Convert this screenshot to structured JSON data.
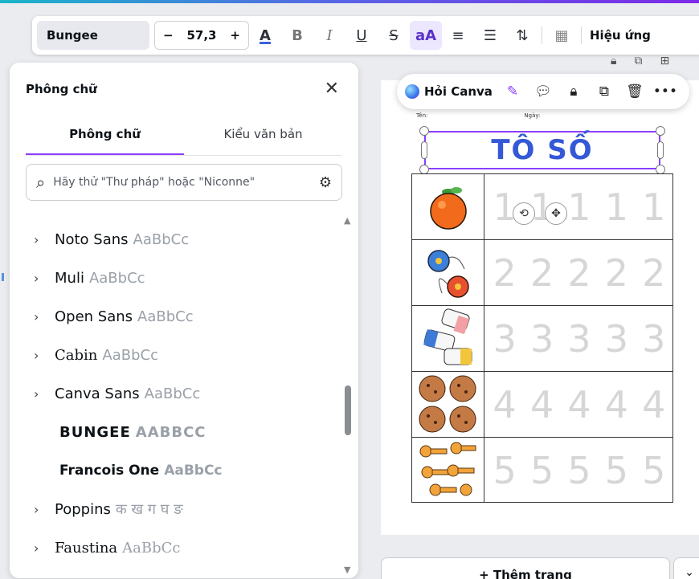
{
  "toolbar": {
    "font_name": "Bungee",
    "size_minus": "−",
    "font_size": "57,3",
    "size_plus": "+",
    "text_color_glyph": "A",
    "bold_glyph": "B",
    "italic_glyph": "I",
    "underline_glyph": "U",
    "strike_glyph": "S",
    "case_glyph": "aA",
    "align_glyph": "≡",
    "list_glyph": "☰",
    "spacing_glyph": "⇅",
    "transparency_glyph": "▦",
    "effects_label": "Hiệu ứng"
  },
  "panel": {
    "title": "Phông chữ",
    "close_glyph": "✕",
    "tabs": [
      {
        "label": "Phông chữ",
        "active": true
      },
      {
        "label": "Kiểu văn bản",
        "active": false
      }
    ],
    "search_placeholder": "Hãy thử \"Thư pháp\" hoặc \"Niconne\"",
    "fonts": [
      {
        "name": "Noto Sans",
        "sample": "AaBbCc",
        "expandable": true
      },
      {
        "name": "Muli",
        "sample": "AaBbCc",
        "expandable": true
      },
      {
        "name": "Open Sans",
        "sample": "AaBbCc",
        "expandable": true
      },
      {
        "name": "Cabin",
        "sample": "AaBbCc",
        "expandable": true
      },
      {
        "name": "Canva Sans",
        "sample": "AaBbCc",
        "expandable": true
      },
      {
        "name": "BUNGEE",
        "sample": "AABBCC",
        "expandable": false
      },
      {
        "name": "Francois One",
        "sample": "AaBbCc",
        "expandable": false
      },
      {
        "name": "Poppins",
        "sample": "क ख ग घ ङ",
        "expandable": true
      },
      {
        "name": "Faustina",
        "sample": "AaBbCc",
        "expandable": true
      }
    ]
  },
  "context_bar": {
    "ask_label": "Hỏi Canva",
    "more_glyph": "•••"
  },
  "worksheet": {
    "name_label": "Tên:",
    "date_label": "Ngày:",
    "title": "TÔ SỐ",
    "rows": [
      {
        "digit": "1",
        "picture": "orange"
      },
      {
        "digit": "2",
        "picture": "yoyo"
      },
      {
        "digit": "3",
        "picture": "eraser"
      },
      {
        "digit": "4",
        "picture": "cookie"
      },
      {
        "digit": "5",
        "picture": "key"
      }
    ]
  },
  "add_page_label": "+ Thêm trang",
  "add_page_more": "⌄",
  "colors": {
    "accent": "#8b3dff",
    "title_blue": "#3458d6"
  }
}
